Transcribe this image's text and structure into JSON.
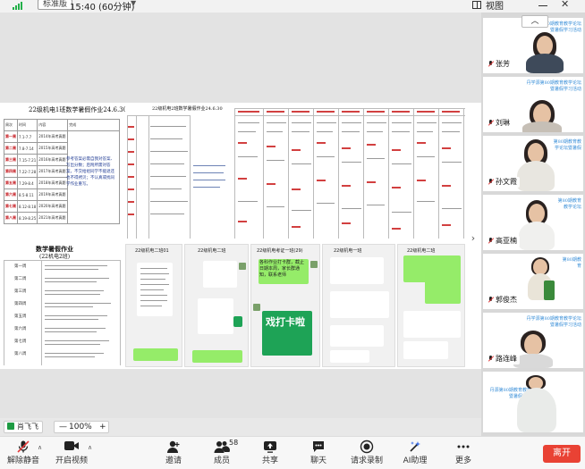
{
  "topbar": {
    "badge": "标准版",
    "timer": "15:40 (60分钟)",
    "view_label": "视图",
    "close_glyph": "✕"
  },
  "share": {
    "doc1_title": "22级机电1班数学暑假作业24.6.30",
    "doc1_headers": [
      "周次",
      "时间",
      "内容",
      "完成"
    ],
    "doc1_rows": [
      [
        "第一周",
        "7.1-7.7",
        "2014年高考真题",
        ""
      ],
      [
        "第二周",
        "7.8-7.14",
        "2015年高考真题",
        ""
      ],
      [
        "第三周",
        "7.15-7.21",
        "2016年高考真题",
        ""
      ],
      [
        "第四周",
        "7.22-7.28",
        "2017年高考真题",
        ""
      ],
      [
        "第五周",
        "7.29-8.4",
        "2018年高考真题",
        ""
      ],
      [
        "第六周",
        "8.5-8.11",
        "2019年高考真题",
        ""
      ],
      [
        "第七周",
        "8.12-8.18",
        "2020年高考真题",
        ""
      ],
      [
        "第八周",
        "8.19-8.25",
        "2021年高考真题",
        ""
      ]
    ],
    "doc1_note": "参考答案必需自我对答案、写出分数；后附所需对答案，不交给组同学不能退还也不得拷贝；不认真或找同学作业重写。",
    "doc2_title": "22级机电2班数学暑假作业24.6.30",
    "doc3_title": "数学暑假作业",
    "doc3_subtitle": "(22机电2班)",
    "doc3_weeks": [
      "第一周",
      "第二周",
      "第三周",
      "第四周",
      "第五周",
      "第六周",
      "第七周",
      "第八周"
    ],
    "chat1_title": "22级机电二班01",
    "chat2_title": "22级机电考证一班(29)",
    "chat2_bubble": "各科作业打卡群，截止日期本周，家长群通知，联系老师",
    "chat2_checkin": "戏打卡啦",
    "chat3_title": "22级机电一班",
    "chat4_title": "22级机电二班"
  },
  "speaker": {
    "name": "肖飞飞"
  },
  "zoom": {
    "minus": "—",
    "value": "100%",
    "plus": "+"
  },
  "videos": [
    {
      "name": "张芳",
      "banner": "丹学源第80期教育教学论坛暨暑假学习活动"
    },
    {
      "name": "刘琳",
      "banner": "丹学源第80期教育教学论坛暨暑假学习活动"
    },
    {
      "name": "孙文霞",
      "banner": "第80期教育教学论坛暨暑假"
    },
    {
      "name": "高亚楠",
      "banner": "第80期教育教学论坛"
    },
    {
      "name": "郭俊杰",
      "banner": "第80期教育"
    },
    {
      "name": "路连峰",
      "banner": "丹学源第80期教育教学论坛暨暑假学习活动"
    },
    {
      "name": "",
      "banner": "丹源第80期教育教学论坛暨暑假学习活动"
    }
  ],
  "collapse_glyph": "︿",
  "next_glyph": "›",
  "toolbar": {
    "items": [
      {
        "key": "unmute",
        "label": "解除静音",
        "icon": "mic-muted-icon"
      },
      {
        "key": "camera",
        "label": "开启视频",
        "icon": "camera-icon"
      },
      {
        "key": "invite",
        "label": "邀请",
        "icon": "add-person-icon"
      },
      {
        "key": "members",
        "label": "成员",
        "icon": "people-icon",
        "count": "58"
      },
      {
        "key": "share",
        "label": "共享",
        "icon": "share-screen-icon"
      },
      {
        "key": "chat",
        "label": "聊天",
        "icon": "chat-icon"
      },
      {
        "key": "record",
        "label": "请求录制",
        "icon": "record-icon"
      },
      {
        "key": "ai",
        "label": "AI助理",
        "icon": "ai-assistant-icon"
      },
      {
        "key": "more",
        "label": "更多",
        "icon": "more-icon"
      }
    ],
    "end_label": "离开"
  },
  "colors": {
    "end_button": "#e94234",
    "signal": "#23b04a",
    "checkin_card": "#1ea356",
    "chat_bubble": "#95ec69"
  }
}
